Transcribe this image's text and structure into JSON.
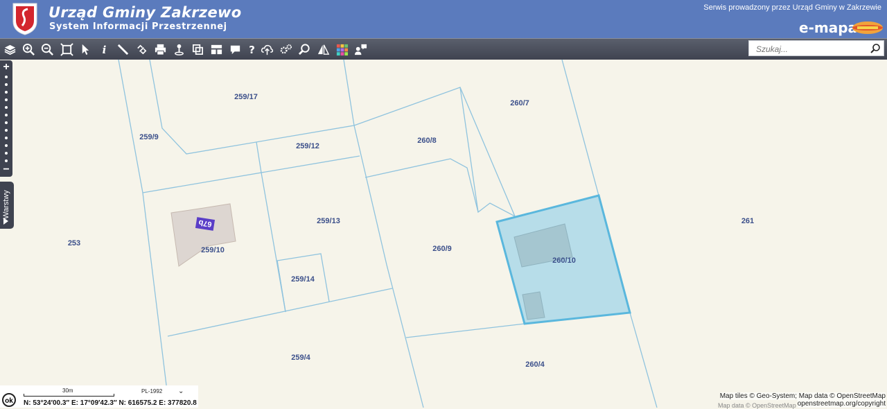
{
  "header": {
    "title": "Urząd Gminy Zakrzewo",
    "subtitle": "System Informacji Przestrzennej",
    "served_by": "Serwis prowadzony przez Urząd Gminy w Zakrzewie",
    "brand": "e-mapa"
  },
  "search": {
    "placeholder": "Szukaj..."
  },
  "side": {
    "layers_label": "Warstwy"
  },
  "parcels": {
    "p259_17": "259/17",
    "p259_9": "259/9",
    "p259_12": "259/12",
    "p260_8": "260/8",
    "p260_7": "260/7",
    "p261": "261",
    "p253": "253",
    "p259_13": "259/13",
    "p259_10": "259/10",
    "p260_9": "260/9",
    "p260_10": "260/10",
    "p259_14": "259/14",
    "p259_4": "259/4",
    "p260_4": "260/4",
    "building_number": "67b"
  },
  "footer": {
    "ok_label": "ok",
    "scale_label": "30m",
    "projection": "PL-1992",
    "coordinates": "N: 53°24′00.3″  E: 17°09′42.3″  N: 616575.2  E: 377820.8",
    "attribution_line1": "Map tiles © Geo-System; Map data © OpenStreetMap",
    "attribution_line2": "openstreetmap.org/copyright",
    "attribution_faded": "Map data © OpenStreetMap"
  },
  "colors": {
    "header": "#5b7bbd",
    "toolbar": "#3f4350",
    "parcel_line": "#8fc3de",
    "selected_fill": "#b7dde9",
    "selected_stroke": "#5ab7dd",
    "label": "#3b4f8a",
    "background": "#f6f4ea"
  }
}
